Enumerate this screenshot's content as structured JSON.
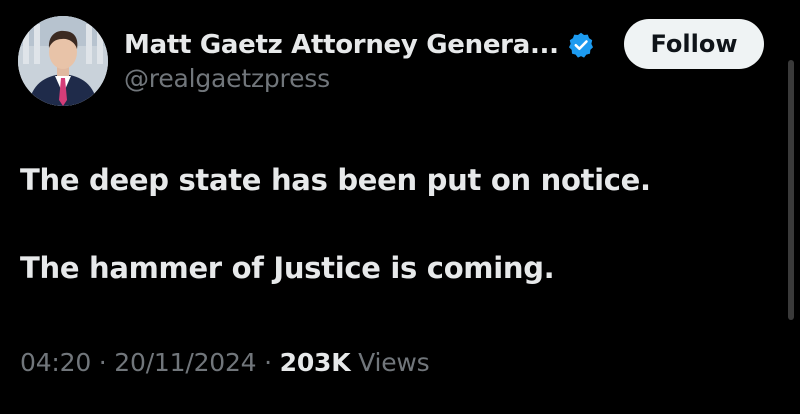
{
  "post": {
    "author": {
      "display_name": "Matt Gaetz Attorney Genera...",
      "handle": "@realgaetzpress",
      "verified": true,
      "verified_color": "#1d9bf0",
      "avatar_icon": "profile-photo"
    },
    "follow_label": "Follow",
    "text": {
      "paragraph_1": "The deep state has been put on notice.",
      "paragraph_2": "The hammer of Justice is coming."
    },
    "meta": {
      "time": "04:20",
      "separator": "·",
      "date": "20/11/2024",
      "views_count": "203K",
      "views_label": "Views"
    }
  },
  "colors": {
    "background": "#000000",
    "primary_text": "#e7e9ea",
    "secondary_text": "#71767b",
    "follow_button_bg": "#eff3f4"
  }
}
